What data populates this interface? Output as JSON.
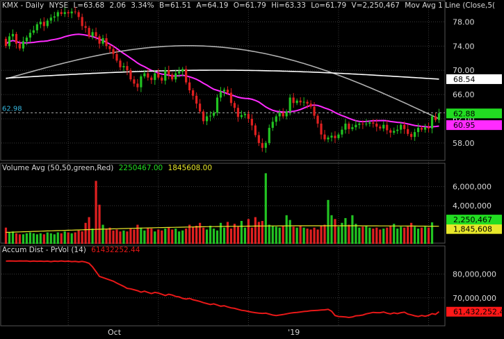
{
  "colors": {
    "bg": "#000000",
    "grid": "#3a3a3a",
    "up": "#22c322",
    "down": "#e02020",
    "text": "#d8d8d8",
    "ma_fast": "#ff2bff",
    "ma_mid": "#b0b0b0",
    "ma_slow": "#ffffff",
    "vol_avg": "#e8e82a",
    "accum": "#e81818",
    "last_price_bg": "#22dd22",
    "fast_ma_bg": "#ff2bff",
    "slow_ma_bg": "#ffffff"
  },
  "price_header": {
    "symbol": "KMX - Daily",
    "exchange": "NYSE",
    "last": "L=63.68",
    "change": "2.06",
    "pct": "3.34%",
    "bid": "B=61.51",
    "ask": "A=64.19",
    "open": "O=61.79",
    "high": "Hi=63.33",
    "low": "Lo=61.79",
    "volume": "V=2,250,467",
    "ma": "Mov Avg 1 Line (Close,5("
  },
  "volume_header": {
    "title": "Volume Avg (50,50,green,Red)",
    "value1": "2250467.00",
    "value2": "1845608.00"
  },
  "accum_header": {
    "title": "Accum Dist - PrVol (14)",
    "value": "61432252.44"
  },
  "price_badges": {
    "left_level": "62.98",
    "ma_slow": "68.54",
    "last": "62.88",
    "ma_fast": "60.95"
  },
  "volume_badges": {
    "vol": "2,250,467",
    "avg": "1,845,608"
  },
  "accum_badge": "61,432,252.44",
  "chart_data": [
    {
      "type": "candlestick",
      "title": "KMX - Daily",
      "x_tick_labels": [
        "Oct",
        "'19"
      ],
      "y_tick_labels": [
        "78.00",
        "74.00",
        "70.00",
        "66.00",
        "62.00",
        "58.00"
      ],
      "ylim": [
        55,
        80
      ],
      "grid": true,
      "ohlc_start": [
        75.2,
        74.0,
        75.6,
        76.0,
        74.4,
        73.6,
        74.8,
        75.4,
        76.2,
        76.6,
        77.6,
        78.0,
        77.3,
        78.2,
        78.7,
        78.9,
        79.6,
        79.3,
        79.6,
        79.4,
        79.7,
        79.6,
        78.8,
        77.3,
        77.0,
        75.6,
        76.3,
        75.6,
        74.4,
        75.3,
        74.0,
        73.5,
        72.7,
        71.6,
        70.5,
        70.7,
        70.0,
        68.5,
        67.8,
        67.2,
        69.0,
        69.5,
        68.8,
        68.4,
        69.5,
        68.8,
        68.3,
        70.0,
        69.3,
        68.5,
        69.5,
        69.8,
        70.2,
        68.0,
        66.7,
        65.8,
        64.5,
        63.2,
        61.6,
        62.4,
        62.5,
        63.0,
        65.5,
        66.5,
        66.8,
        66.3,
        64.6,
        63.8,
        62.3,
        62.6,
        62.8,
        62.0,
        60.9,
        59.3,
        58.0,
        57.2,
        58.0,
        60.5,
        61.5,
        62.4,
        63.0,
        62.4,
        63.2,
        65.5,
        64.6,
        65.0,
        64.7,
        64.8,
        64.5,
        64.0,
        62.5,
        61.2,
        59.4,
        58.6,
        58.9,
        59.2,
        58.8,
        59.4,
        60.2,
        61.2,
        60.3,
        60.6,
        61.0,
        61.2,
        61.1,
        61.2,
        61.4,
        61.2,
        60.7,
        60.4,
        61.0,
        60.1,
        59.7,
        60.0,
        60.2,
        61.0,
        60.3,
        59.5,
        59.0,
        59.8,
        60.5,
        60.2,
        60.6,
        60.4,
        62.4,
        61.8
      ],
      "ohlc_close": [
        74.0,
        75.6,
        76.0,
        74.4,
        73.6,
        74.8,
        75.4,
        76.2,
        76.6,
        77.6,
        78.0,
        77.3,
        78.2,
        78.7,
        78.9,
        79.6,
        79.3,
        79.6,
        79.4,
        79.7,
        79.6,
        78.8,
        77.3,
        77.0,
        75.6,
        76.3,
        75.6,
        74.4,
        75.3,
        74.0,
        73.5,
        72.7,
        71.6,
        70.5,
        70.7,
        70.0,
        68.5,
        67.8,
        67.2,
        69.0,
        69.5,
        68.8,
        68.4,
        69.5,
        68.8,
        68.3,
        70.0,
        69.3,
        68.5,
        69.5,
        69.8,
        70.2,
        68.0,
        66.7,
        65.8,
        64.5,
        63.2,
        61.6,
        62.4,
        62.5,
        63.0,
        65.5,
        66.5,
        66.8,
        66.3,
        64.6,
        63.8,
        62.3,
        62.6,
        62.8,
        62.0,
        60.9,
        59.3,
        58.0,
        57.2,
        58.0,
        60.5,
        61.5,
        62.4,
        63.0,
        62.4,
        63.2,
        65.5,
        64.6,
        65.0,
        64.7,
        64.8,
        64.5,
        64.0,
        62.5,
        61.2,
        59.4,
        58.6,
        58.9,
        59.2,
        58.8,
        59.4,
        60.2,
        61.2,
        60.3,
        60.6,
        61.0,
        61.2,
        61.1,
        61.2,
        61.4,
        61.2,
        60.7,
        60.4,
        61.0,
        60.1,
        59.7,
        60.0,
        60.2,
        61.0,
        60.3,
        59.5,
        59.0,
        59.8,
        60.5,
        60.2,
        60.6,
        60.4,
        62.4,
        61.8,
        62.9
      ],
      "series": [
        {
          "name": "",
          "color": "#ff2bff",
          "start": 74.8,
          "end": 60.95
        },
        {
          "name": "",
          "color": "#b0b0b0",
          "start": 68.6,
          "end": 62.0
        },
        {
          "name": "",
          "color": "#ffffff",
          "start": 68.7,
          "end": 68.54
        }
      ]
    },
    {
      "type": "bar",
      "title": "Volume Avg (50,50,green,Red)",
      "y_tick_labels": [
        "6,000,000",
        "4,000,000"
      ],
      "ylim": [
        0,
        7500000
      ],
      "values": [
        1700000,
        1200000,
        1300000,
        1100000,
        1000000,
        1000000,
        1100000,
        1200000,
        1100000,
        1000000,
        1100000,
        1000000,
        1200000,
        1100000,
        1000000,
        1200000,
        1100000,
        1300000,
        1200000,
        1100000,
        1200000,
        1400000,
        1300000,
        2200000,
        2800000,
        1600000,
        6600000,
        4100000,
        2000000,
        1600000,
        1700000,
        1400000,
        1500000,
        1300000,
        1400000,
        1300000,
        1600000,
        1500000,
        2000000,
        1700000,
        1400000,
        1700000,
        1600000,
        1300000,
        1500000,
        1400000,
        1600000,
        1700000,
        1500000,
        1600000,
        1300000,
        1400000,
        1600000,
        2000000,
        1800000,
        1900000,
        2200000,
        1700000,
        1500000,
        1900000,
        1600000,
        1400000,
        2200000,
        1700000,
        2300000,
        1600000,
        2100000,
        1800000,
        2400000,
        1700000,
        2600000,
        1700000,
        2800000,
        2300000,
        2400000,
        7400000,
        2000000,
        1900000,
        1800000,
        1700000,
        1900000,
        3000000,
        2500000,
        1800000,
        1700000,
        1900000,
        1700000,
        1600000,
        1500000,
        1700000,
        1500000,
        1900000,
        2000000,
        4600000,
        3000000,
        2600000,
        1800000,
        2200000,
        2700000,
        2000000,
        3000000,
        2100000,
        1700000,
        1800000,
        1900000,
        1700000,
        1600000,
        1700000,
        1500000,
        1600000,
        1700000,
        1900000,
        2100000,
        1600000,
        1800000,
        1700000,
        1800000,
        2200000,
        1800000,
        1600000,
        1700000,
        1800000,
        1700000,
        2250467
      ],
      "series": [
        {
          "name": "",
          "color": "#e8e82a",
          "start": 1200000,
          "end": 1845608
        }
      ]
    },
    {
      "type": "line",
      "title": "Accum Dist - PrVol (14)",
      "y_tick_labels": [
        "80,000,000",
        "70,000,000"
      ],
      "ylim": [
        58000000,
        88000000
      ],
      "values": [
        85400000,
        85500000,
        85450000,
        85400000,
        85500000,
        85450000,
        85500000,
        85300000,
        85450000,
        85350000,
        85400000,
        85300000,
        85400000,
        85200000,
        85400000,
        85300000,
        85500000,
        85300000,
        85400000,
        85200000,
        85300000,
        85100000,
        85300000,
        85000000,
        84500000,
        83000000,
        81000000,
        79000000,
        78500000,
        78000000,
        77500000,
        77000000,
        76200000,
        75500000,
        74800000,
        74000000,
        73800000,
        73400000,
        73000000,
        72400000,
        72800000,
        72300000,
        71800000,
        72300000,
        72000000,
        71500000,
        71000000,
        71500000,
        71200000,
        70600000,
        70400000,
        69800000,
        69500000,
        69800000,
        69200000,
        68900000,
        68500000,
        68000000,
        67600000,
        67200000,
        67500000,
        67000000,
        66500000,
        66700000,
        66200000,
        65800000,
        65600000,
        65200000,
        64800000,
        64600000,
        64300000,
        64000000,
        63800000,
        63600000,
        63500000,
        63600000,
        63200000,
        62800000,
        62600000,
        62800000,
        63000000,
        63300000,
        63600000,
        63800000,
        63900000,
        64100000,
        64300000,
        64400000,
        64600000,
        64700000,
        64800000,
        64900000,
        65000000,
        65200000,
        64400000,
        62600000,
        62200000,
        62100000,
        62000000,
        61800000,
        62000000,
        62500000,
        62600000,
        62800000,
        63300000,
        63600000,
        63900000,
        63800000,
        63800000,
        64100000,
        63600000,
        63300000,
        63700000,
        63400000,
        63800000,
        64000000,
        63200000,
        62900000,
        62500000,
        62200000,
        62600000,
        62300000,
        62700000,
        63400000,
        63100000,
        64200000
      ]
    }
  ]
}
